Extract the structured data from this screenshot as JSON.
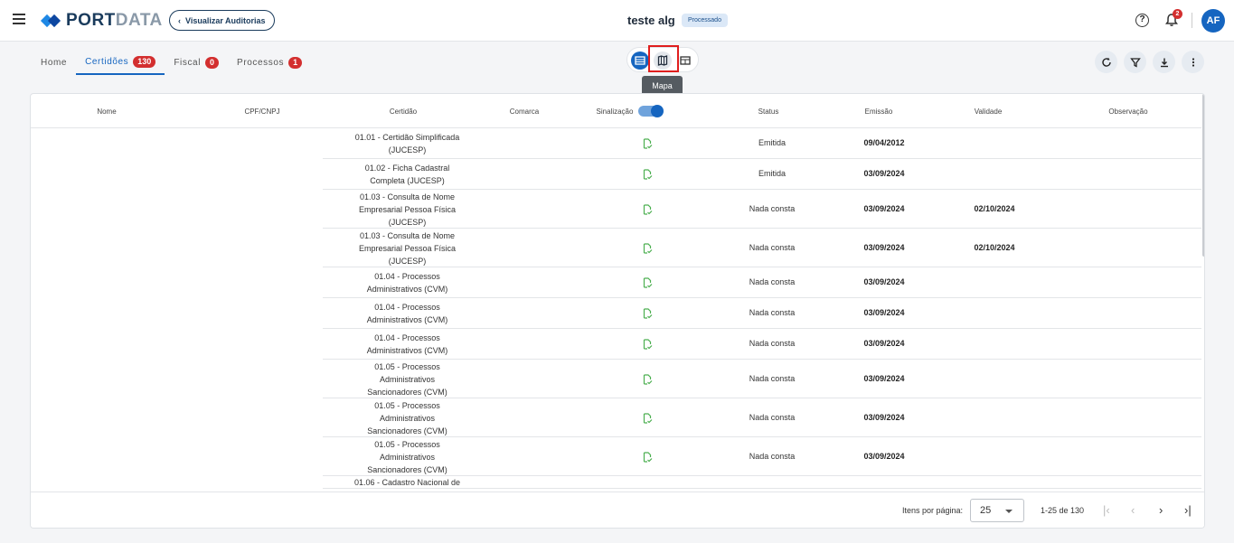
{
  "header": {
    "brand_main": "PORT",
    "brand_accent": "DATA",
    "back_button": "Visualizar Auditorias",
    "page_title": "teste alg",
    "status_badge": "Processado",
    "notifications_count": "2",
    "avatar_initials": "AF"
  },
  "tabs": [
    {
      "label": "Home",
      "count": ""
    },
    {
      "label": "Certidões",
      "count": "130"
    },
    {
      "label": "Fiscal",
      "count": "0"
    },
    {
      "label": "Processos",
      "count": "1"
    }
  ],
  "view_toggle": {
    "tooltip": "Mapa"
  },
  "table": {
    "columns": {
      "nome": "Nome",
      "cpf": "CPF/CNPJ",
      "certidao": "Certidão",
      "comarca": "Comarca",
      "sinalizacao": "Sinalização",
      "status": "Status",
      "emissao": "Emissão",
      "validade": "Validade",
      "observacao": "Observação"
    },
    "rows": [
      {
        "certidao": [
          "01.01 - Certidão Simplificada",
          "(JUCESP)"
        ],
        "status": "Emitida",
        "emissao": "09/04/2012",
        "validade": ""
      },
      {
        "certidao": [
          "01.02 - Ficha Cadastral",
          "Completa (JUCESP)"
        ],
        "status": "Emitida",
        "emissao": "03/09/2024",
        "validade": ""
      },
      {
        "certidao": [
          "01.03 - Consulta de Nome",
          "Empresarial Pessoa Física",
          "(JUCESP)"
        ],
        "status": "Nada consta",
        "emissao": "03/09/2024",
        "validade": "02/10/2024"
      },
      {
        "certidao": [
          "01.03 - Consulta de Nome",
          "Empresarial Pessoa Física",
          "(JUCESP)"
        ],
        "status": "Nada consta",
        "emissao": "03/09/2024",
        "validade": "02/10/2024"
      },
      {
        "certidao": [
          "01.04 - Processos",
          "Administrativos (CVM)"
        ],
        "status": "Nada consta",
        "emissao": "03/09/2024",
        "validade": ""
      },
      {
        "certidao": [
          "01.04 - Processos",
          "Administrativos (CVM)"
        ],
        "status": "Nada consta",
        "emissao": "03/09/2024",
        "validade": ""
      },
      {
        "certidao": [
          "01.04 - Processos",
          "Administrativos (CVM)"
        ],
        "status": "Nada consta",
        "emissao": "03/09/2024",
        "validade": ""
      },
      {
        "certidao": [
          "01.05 - Processos",
          "Administrativos",
          "Sancionadores (CVM)"
        ],
        "status": "Nada consta",
        "emissao": "03/09/2024",
        "validade": ""
      },
      {
        "certidao": [
          "01.05 - Processos",
          "Administrativos",
          "Sancionadores (CVM)"
        ],
        "status": "Nada consta",
        "emissao": "03/09/2024",
        "validade": ""
      },
      {
        "certidao": [
          "01.05 - Processos",
          "Administrativos",
          "Sancionadores (CVM)"
        ],
        "status": "Nada consta",
        "emissao": "03/09/2024",
        "validade": ""
      },
      {
        "certidao": [
          "01.06 - Cadastro Nacional de"
        ],
        "status": "",
        "emissao": "",
        "validade": ""
      }
    ]
  },
  "pagination": {
    "items_per_page_label": "Itens por página:",
    "items_per_page_value": "25",
    "range": "1-25 de 130"
  },
  "colors": {
    "primary": "#1565c0",
    "danger": "#d32f2f",
    "doc_icon": "#4caf50"
  }
}
